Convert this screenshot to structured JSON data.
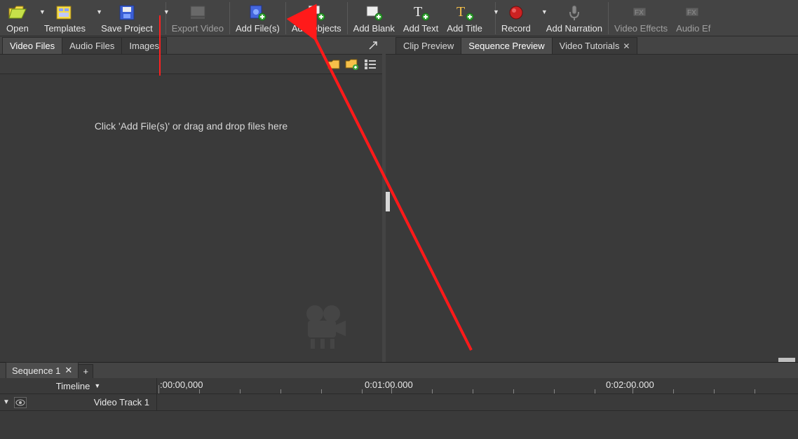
{
  "toolbar": {
    "open": "Open",
    "templates": "Templates",
    "save_project": "Save Project",
    "export_video": "Export Video",
    "add_files": "Add File(s)",
    "add_objects": "Add Objects",
    "add_blank": "Add Blank",
    "add_text": "Add Text",
    "add_title": "Add Title",
    "record": "Record",
    "add_narration": "Add Narration",
    "video_effects": "Video Effects",
    "audio_effects": "Audio Ef"
  },
  "left_tabs": {
    "video_files": "Video Files",
    "audio_files": "Audio Files",
    "images": "Images"
  },
  "gallery": {
    "drop_text": "Click 'Add File(s)' or drag and drop files here"
  },
  "right_tabs": {
    "clip_preview": "Clip Preview",
    "sequence_preview": "Sequence Preview",
    "video_tutorials": "Video Tutorials"
  },
  "timeline": {
    "sequence_tab": "Sequence 1",
    "label": "Timeline",
    "t0": ":00:00,000",
    "t1": "0:01:00.000",
    "t2": "0:02:00.000",
    "track1": "Video Track 1",
    "plus": "+"
  }
}
